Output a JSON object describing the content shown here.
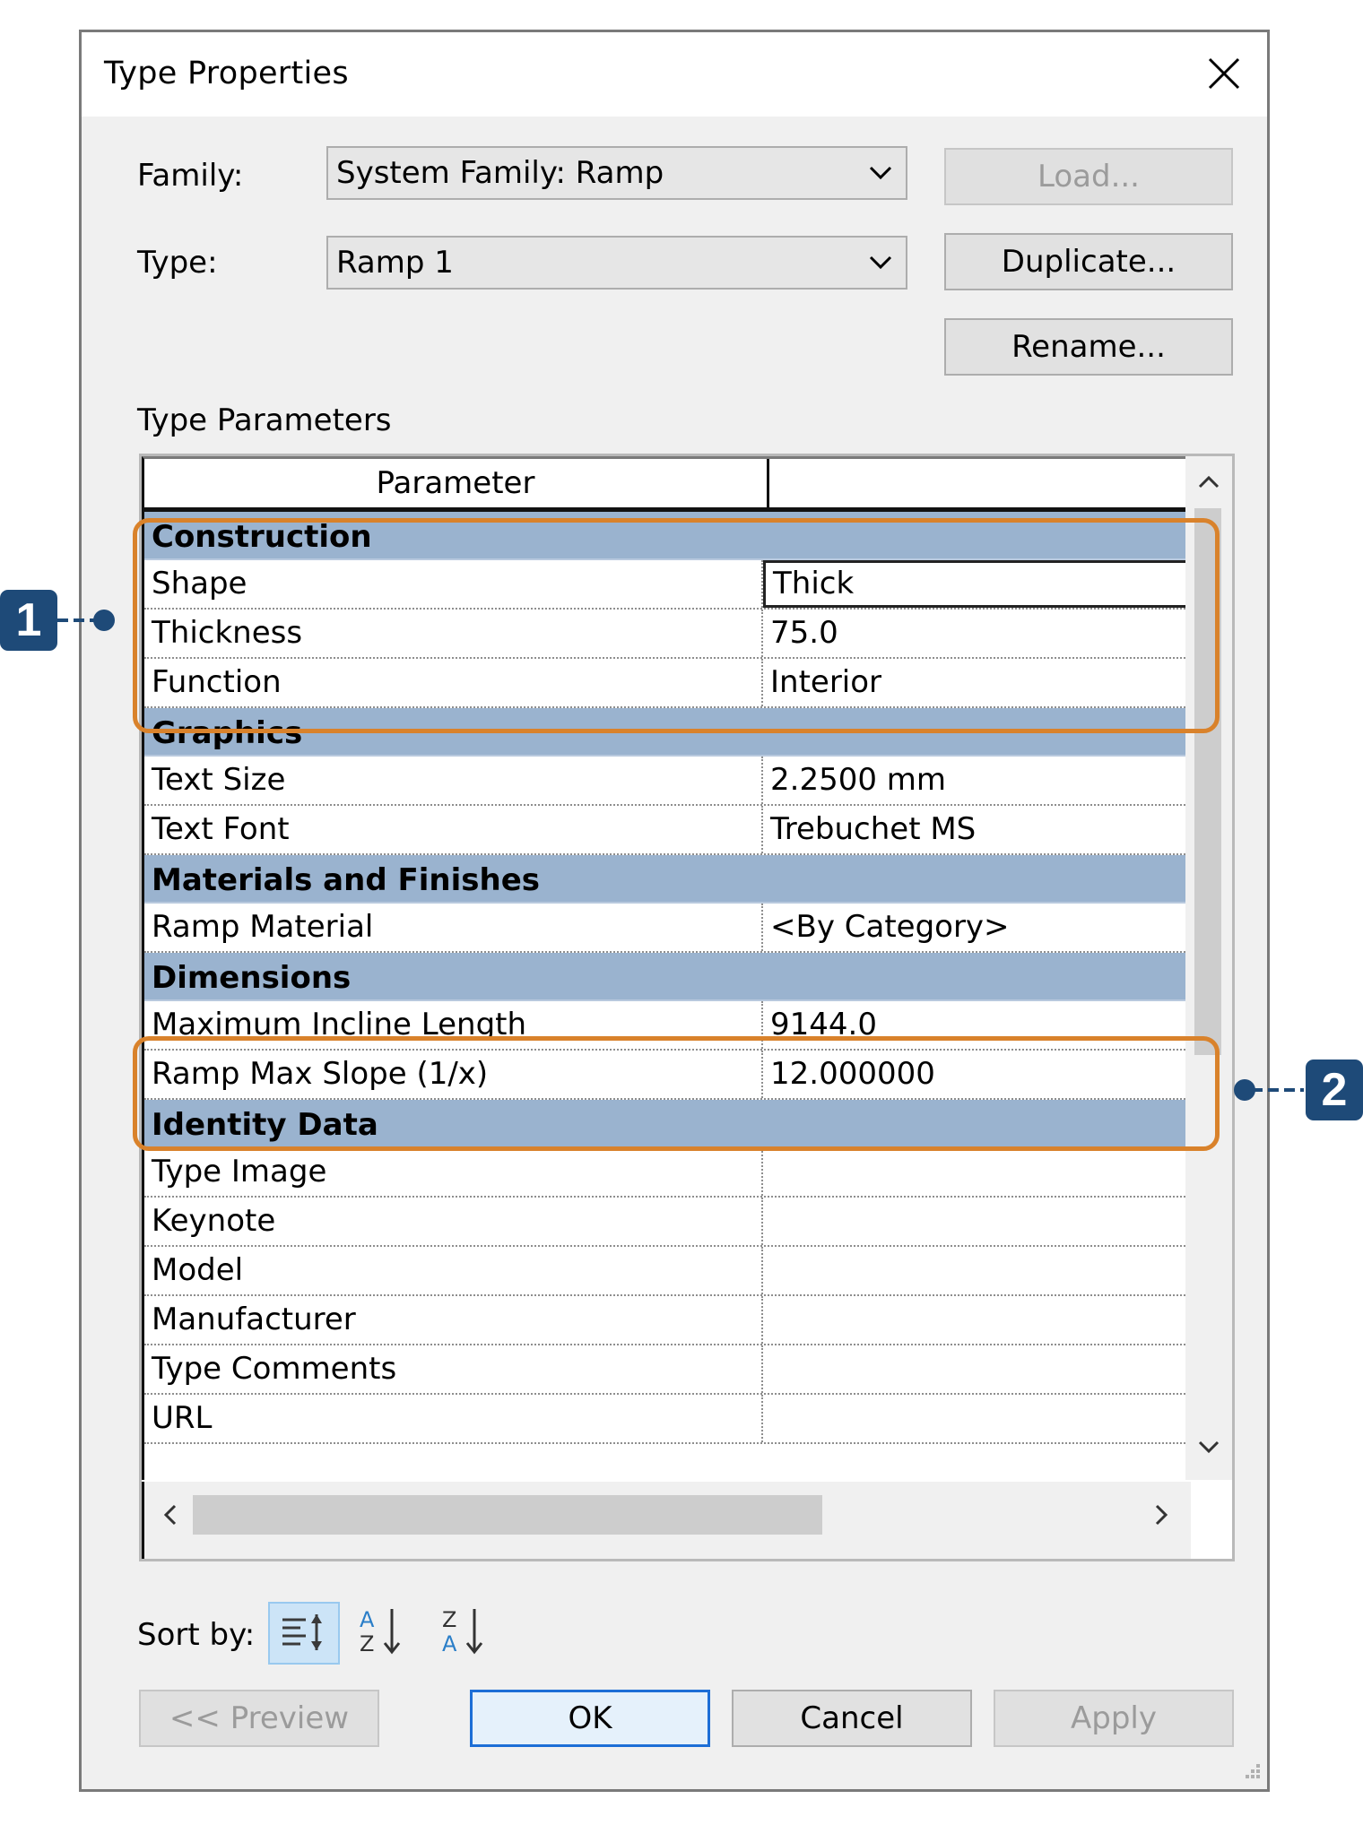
{
  "dialog": {
    "title": "Type Properties",
    "family_label": "Family:",
    "family_value": "System Family: Ramp",
    "type_label": "Type:",
    "type_value": "Ramp 1",
    "load_label": "Load...",
    "duplicate_label": "Duplicate...",
    "rename_label": "Rename...",
    "type_parameters_label": "Type Parameters",
    "grid_header_parameter": "Parameter",
    "grid_header_value": "",
    "groups": [
      {
        "name": "Construction",
        "rows": [
          {
            "name": "Shape",
            "value": "Thick"
          },
          {
            "name": "Thickness",
            "value": "75.0"
          },
          {
            "name": "Function",
            "value": "Interior"
          }
        ]
      },
      {
        "name": "Graphics",
        "rows": [
          {
            "name": "Text Size",
            "value": "2.2500 mm"
          },
          {
            "name": "Text Font",
            "value": "Trebuchet MS"
          }
        ]
      },
      {
        "name": "Materials and Finishes",
        "rows": [
          {
            "name": "Ramp Material",
            "value": "<By Category>"
          }
        ]
      },
      {
        "name": "Dimensions",
        "rows": [
          {
            "name": "Maximum Incline Length",
            "value": "9144.0"
          },
          {
            "name": "Ramp Max Slope (1/x)",
            "value": "12.000000"
          }
        ]
      },
      {
        "name": "Identity Data",
        "rows": [
          {
            "name": "Type Image",
            "value": ""
          },
          {
            "name": "Keynote",
            "value": ""
          },
          {
            "name": "Model",
            "value": ""
          },
          {
            "name": "Manufacturer",
            "value": ""
          },
          {
            "name": "Type Comments",
            "value": ""
          },
          {
            "name": "URL",
            "value": ""
          }
        ]
      }
    ],
    "sort_by_label": "Sort by:",
    "preview_label": "<< Preview",
    "ok_label": "OK",
    "cancel_label": "Cancel",
    "apply_label": "Apply"
  },
  "callouts": {
    "one": "1",
    "two": "2"
  },
  "icons": {
    "close": "close-icon",
    "dropdown": "chevron-down-icon",
    "sort_grouped": "sort-grouped-icon",
    "sort_az": "sort-ascending-icon",
    "sort_za": "sort-descending-icon"
  },
  "colors": {
    "group_header": "#9ab3cf",
    "callout_outline": "#d9822b",
    "callout_badge": "#1e4a78",
    "default_button_border": "#1c6ed6"
  }
}
